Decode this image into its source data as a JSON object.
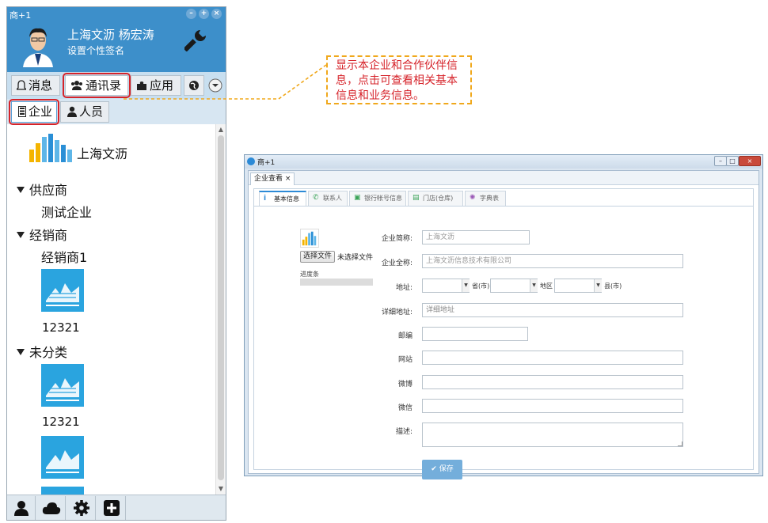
{
  "messenger": {
    "window_title": "商+1",
    "user_name": "上海文沥 杨宏涛",
    "signature": "设置个性签名",
    "tabs": [
      {
        "label": "消息",
        "icon": "bell-icon"
      },
      {
        "label": "通讯录",
        "icon": "contacts-icon"
      },
      {
        "label": "应用",
        "icon": "puzzle-icon"
      }
    ],
    "subtabs": [
      {
        "label": "企业",
        "icon": "building-icon"
      },
      {
        "label": "人员",
        "icon": "person-icon"
      }
    ],
    "company": "上海文沥",
    "groups": [
      {
        "name": "供应商",
        "entries": [
          "测试企业"
        ]
      },
      {
        "name": "经销商",
        "entries": [
          "经销商1"
        ],
        "tiles": [
          "12321"
        ]
      },
      {
        "name": "未分类",
        "tiles": [
          "12321"
        ]
      }
    ],
    "bottom_icons": [
      "user-icon",
      "cloud-icon",
      "gear-icon",
      "plus-box-icon"
    ],
    "colors": {
      "header": "#3d8fca",
      "highlight": "#d6232a",
      "tile": "#2aa4df"
    }
  },
  "callout": {
    "text": "显示本企业和合作伙伴信息，点击可查看相关基本信息和业务信息。",
    "color": "#d6232a",
    "border": "#f0a81c"
  },
  "viewer": {
    "window_title": "商+1",
    "doc_tab": "企业查看",
    "tabs": [
      {
        "label": "基本信息",
        "icon": "info-icon",
        "active": true
      },
      {
        "label": "联系人",
        "icon": "phone-icon"
      },
      {
        "label": "银行帐号信息",
        "icon": "bank-card-icon"
      },
      {
        "label": "门店(仓库)",
        "icon": "store-icon"
      },
      {
        "label": "字典表",
        "icon": "gear-icon"
      }
    ],
    "file_button": "选择文件",
    "file_status": "未选择文件",
    "progress_label": "进度条",
    "fields": {
      "short_name": {
        "label": "企业简称:",
        "value": "上海文沥"
      },
      "full_name": {
        "label": "企业全称:",
        "value": "上海文沥信息技术有限公司"
      },
      "address": {
        "label": "地址:",
        "province_unit": "省(市)",
        "district_unit": "地区",
        "county_unit": "县(市)"
      },
      "detail_address": {
        "label": "详细地址:",
        "placeholder": "详细地址"
      },
      "postcode": {
        "label": "邮编"
      },
      "website": {
        "label": "网站"
      },
      "weibo": {
        "label": "微博"
      },
      "wechat": {
        "label": "微信"
      },
      "description": {
        "label": "描述:"
      }
    },
    "save_label": "✔ 保存"
  }
}
